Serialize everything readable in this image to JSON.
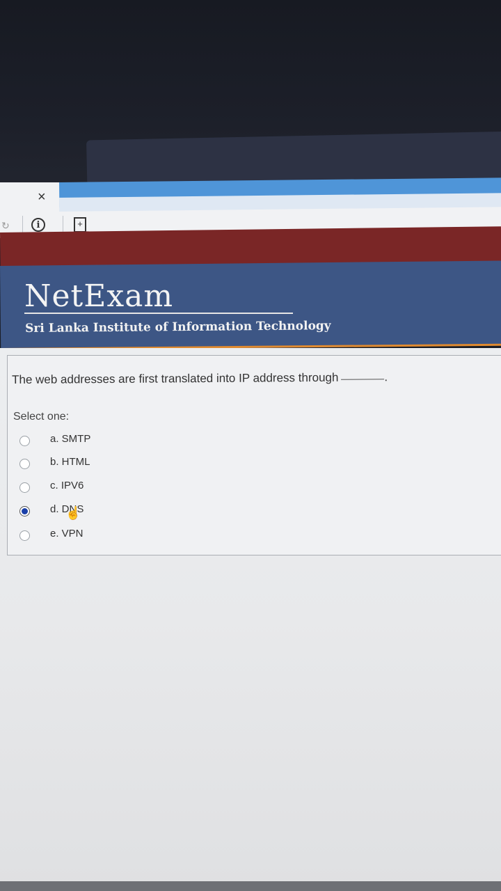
{
  "browser": {
    "close_glyph": "×",
    "icons": [
      "info-icon",
      "page-icon"
    ]
  },
  "banner": {
    "logo": "NetExam",
    "institution": "Sri Lanka Institute of Information Technology",
    "colors": {
      "red": "#7a2626",
      "blue": "#3d5685",
      "accent": "#e08a2f"
    }
  },
  "question": {
    "text": "The web addresses are first translated into IP address through",
    "blank_suffix": ".",
    "prompt": "Select one:",
    "options": [
      {
        "label": "a. SMTP",
        "selected": false
      },
      {
        "label": "b. HTML",
        "selected": false
      },
      {
        "label": "c. IPV6",
        "selected": false
      },
      {
        "label": "d. DNS",
        "selected": true
      },
      {
        "label": "e. VPN",
        "selected": false
      }
    ]
  }
}
